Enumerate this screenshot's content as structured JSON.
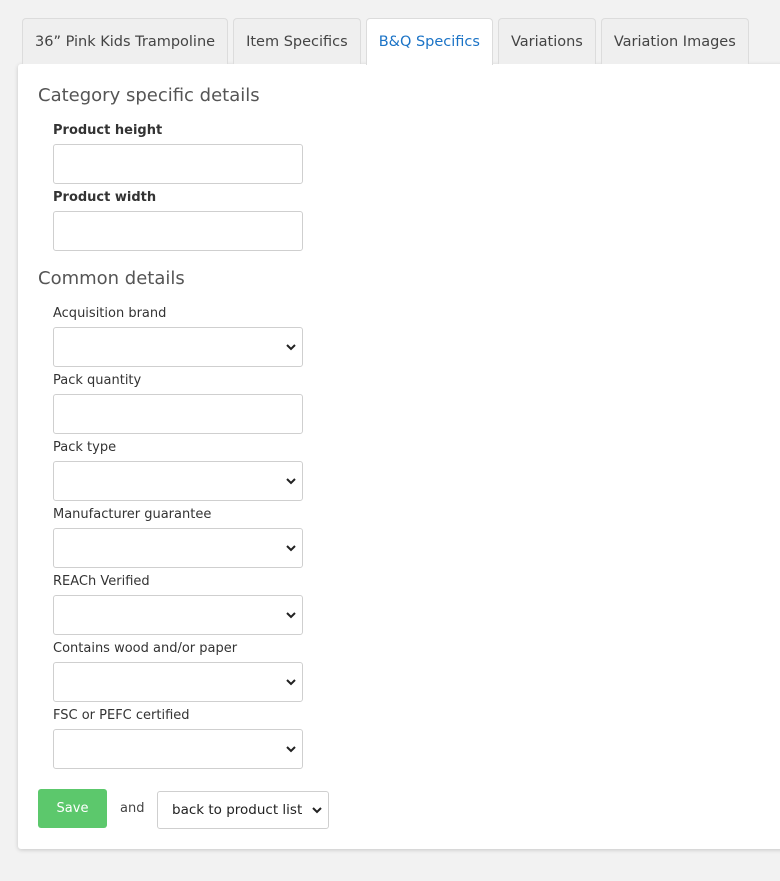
{
  "tabs": [
    {
      "label": "36” Pink Kids Trampoline",
      "active": false
    },
    {
      "label": "Item Specifics",
      "active": false
    },
    {
      "label": "B&Q Specifics",
      "active": true
    },
    {
      "label": "Variations",
      "active": false
    },
    {
      "label": "Variation Images",
      "active": false
    }
  ],
  "category_section": {
    "title": "Category specific details",
    "fields": [
      {
        "label": "Product height",
        "type": "text",
        "value": ""
      },
      {
        "label": "Product width",
        "type": "text",
        "value": ""
      }
    ]
  },
  "common_section": {
    "title": "Common details",
    "fields": [
      {
        "label": "Acquisition brand",
        "type": "select",
        "value": ""
      },
      {
        "label": "Pack quantity",
        "type": "text",
        "value": ""
      },
      {
        "label": "Pack type",
        "type": "select",
        "value": ""
      },
      {
        "label": "Manufacturer guarantee",
        "type": "select",
        "value": ""
      },
      {
        "label": "REACh Verified",
        "type": "select",
        "value": ""
      },
      {
        "label": "Contains wood and/or paper",
        "type": "select",
        "value": ""
      },
      {
        "label": "FSC or PEFC certified",
        "type": "select",
        "value": ""
      }
    ]
  },
  "actions": {
    "save_label": "Save",
    "and_text": "and",
    "after_save_selected": "back to product list"
  },
  "colors": {
    "accent": "#1b73c6",
    "save_button": "#5cc86c",
    "background": "#f2f2f2"
  }
}
